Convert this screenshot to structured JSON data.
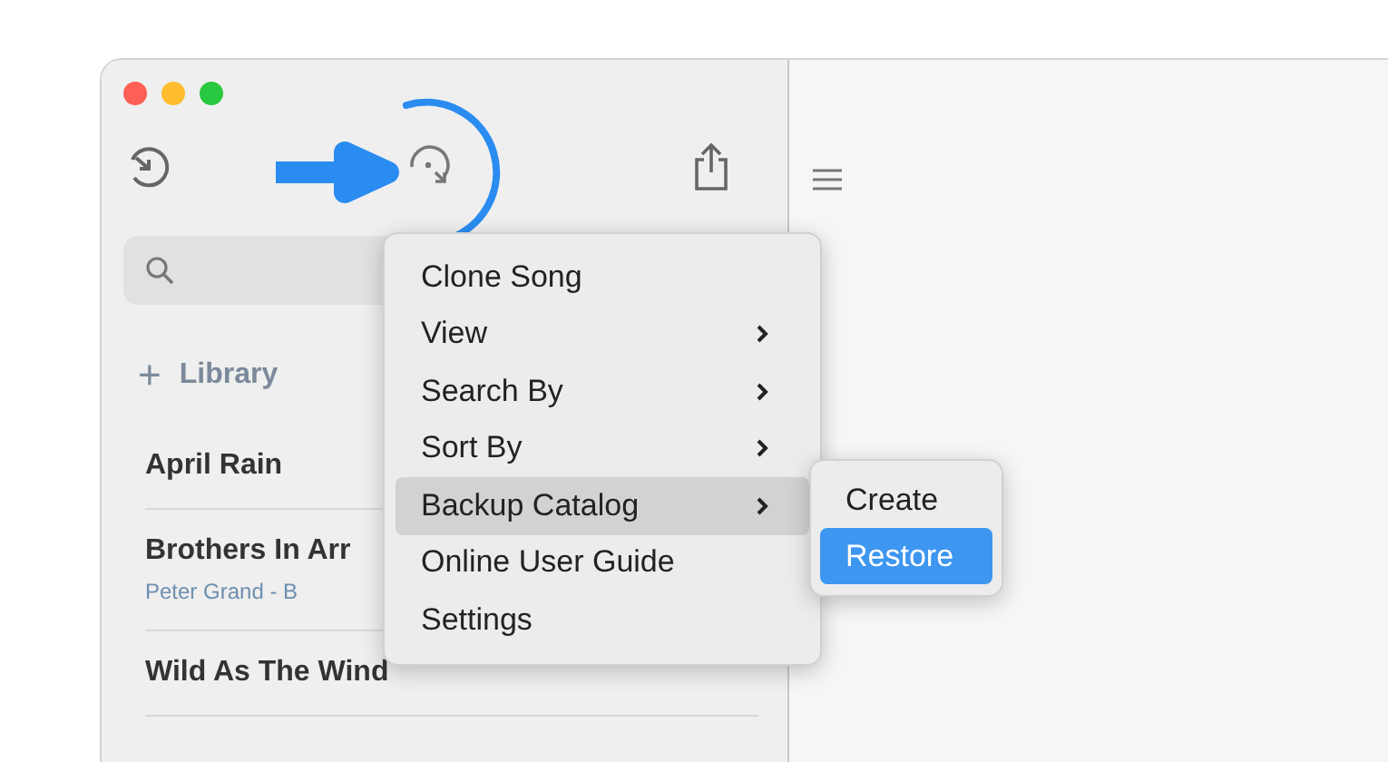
{
  "sidebar": {
    "section": {
      "icon": "+",
      "label": "Library"
    },
    "songs": [
      {
        "title": "April Rain"
      },
      {
        "title": "Brothers In Arr",
        "subtitle": "Peter Grand - B"
      },
      {
        "title": "Wild As The Wind"
      }
    ]
  },
  "menu": {
    "items": [
      {
        "label": "Clone Song",
        "submenu": false,
        "selected": false
      },
      {
        "label": "View",
        "submenu": true,
        "selected": false
      },
      {
        "label": "Search By",
        "submenu": true,
        "selected": false
      },
      {
        "label": "Sort By",
        "submenu": true,
        "selected": false
      },
      {
        "label": "Backup Catalog",
        "submenu": true,
        "selected": true
      },
      {
        "label": "Online User Guide",
        "submenu": false,
        "selected": false
      },
      {
        "label": "Settings",
        "submenu": false,
        "selected": false
      }
    ],
    "submenu": [
      {
        "label": "Create",
        "selected": false
      },
      {
        "label": "Restore",
        "selected": true
      }
    ]
  }
}
